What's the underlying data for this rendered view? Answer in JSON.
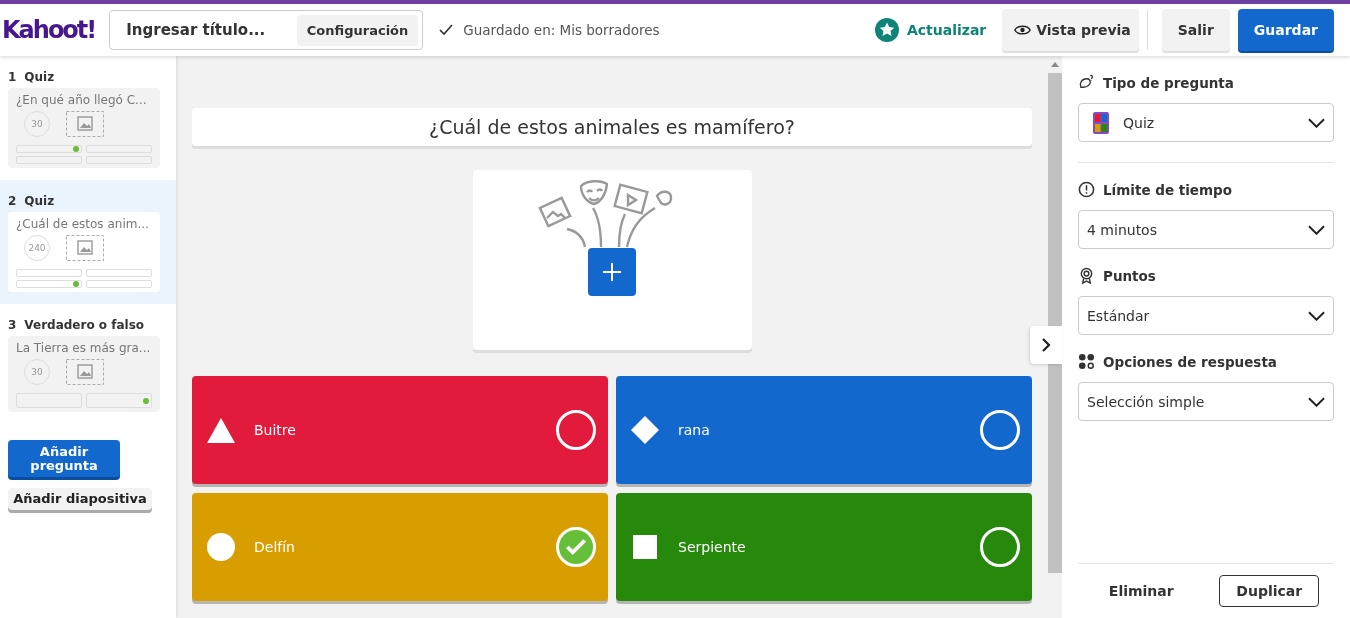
{
  "header": {
    "logo": "Kahoot!",
    "title_placeholder": "Ingresar título...",
    "settings_button": "Configuración",
    "saved_status": "Guardado en: Mis borradores",
    "upgrade": "Actualizar",
    "preview": "Vista previa",
    "exit": "Salir",
    "save": "Guardar"
  },
  "slides": [
    {
      "number": "1",
      "type": "Quiz",
      "title": "¿En qué año llegó C...",
      "time": "30",
      "selected": false,
      "answers": [
        {
          "correct": true
        },
        {
          "correct": false
        },
        {
          "correct": false
        },
        {
          "correct": false
        }
      ]
    },
    {
      "number": "2",
      "type": "Quiz",
      "title": "¿Cuál de estos anim...",
      "time": "240",
      "selected": true,
      "answers": [
        {
          "correct": false
        },
        {
          "correct": false
        },
        {
          "correct": true
        },
        {
          "correct": false
        }
      ]
    },
    {
      "number": "3",
      "type": "Verdadero o falso",
      "title": "La Tierra es más gra...",
      "time": "30",
      "selected": false,
      "answers": [
        {
          "correct": false
        },
        {
          "correct": true
        }
      ]
    }
  ],
  "sidebar_buttons": {
    "add_question": "Añadir pregunta",
    "add_slide": "Añadir diapositiva"
  },
  "question": {
    "text": "¿Cuál de estos animales es mamífero?"
  },
  "answers": [
    {
      "kind": "triangle",
      "text": "Buitre",
      "color": "#e21b3c",
      "correct": false
    },
    {
      "kind": "diamond",
      "text": "rana",
      "color": "#1368ce",
      "correct": false
    },
    {
      "kind": "circle",
      "text": "Delfín",
      "color": "#d89e00",
      "correct": true
    },
    {
      "kind": "square",
      "text": "Serpiente",
      "color": "#26890c",
      "correct": false
    }
  ],
  "settings": [
    {
      "kind": "type",
      "label": "Tipo de pregunta",
      "value": "Quiz"
    },
    {
      "kind": "time",
      "label": "Límite de tiempo",
      "value": "4 minutos"
    },
    {
      "kind": "points",
      "label": "Puntos",
      "value": "Estándar"
    },
    {
      "kind": "options",
      "label": "Opciones de respuesta",
      "value": "Selección simple"
    }
  ],
  "panel_buttons": {
    "delete": "Eliminar",
    "duplicate": "Duplicar"
  }
}
